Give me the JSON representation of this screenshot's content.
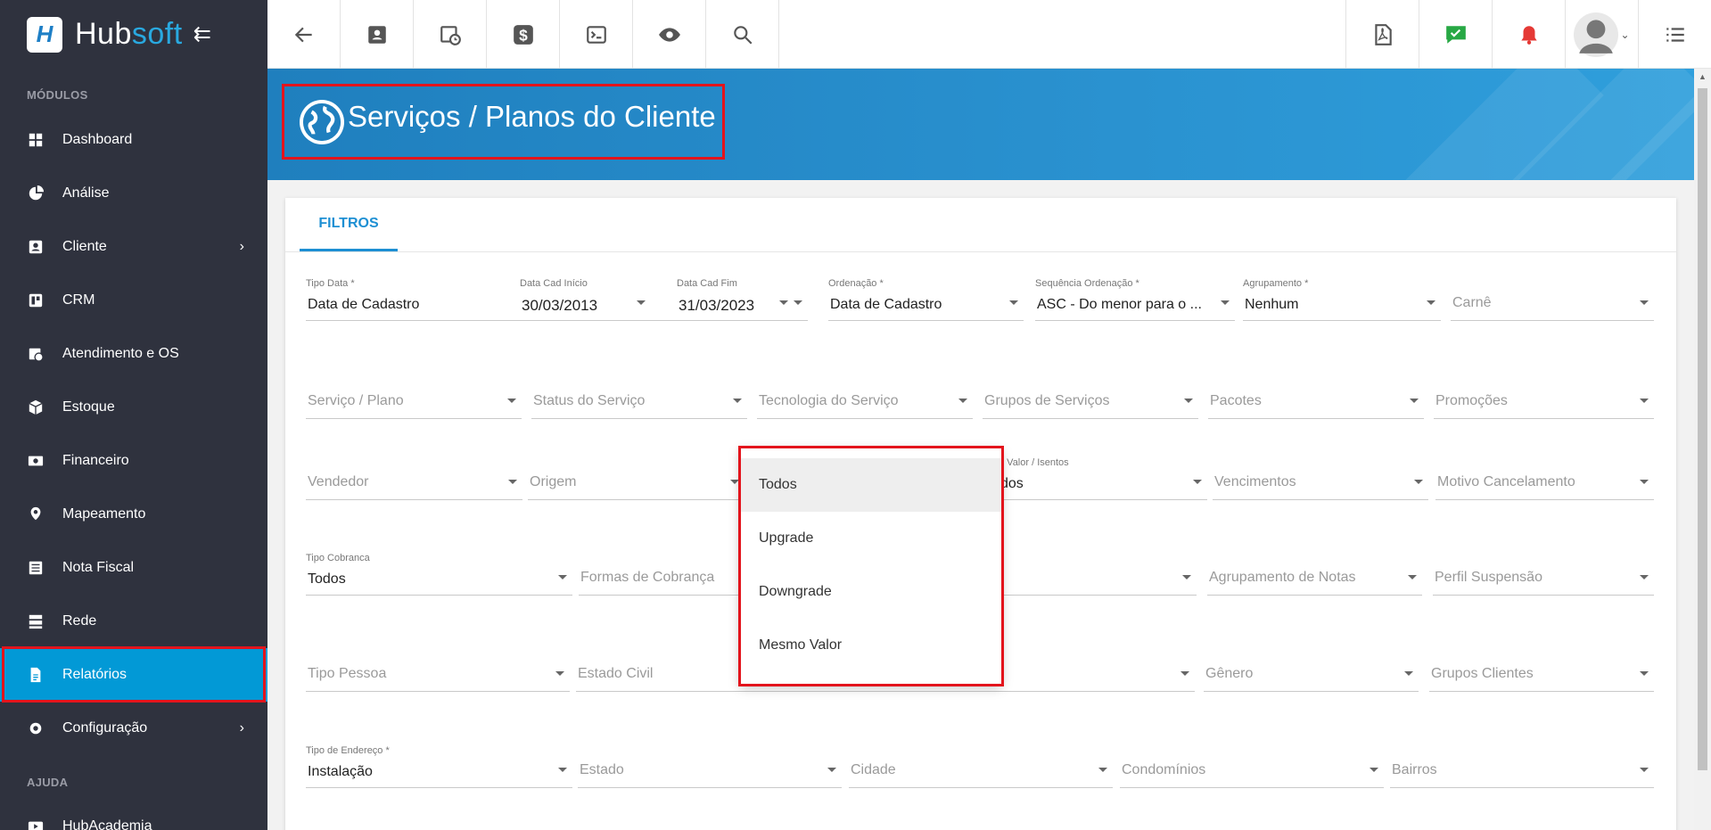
{
  "brand": {
    "hub": "Hub",
    "soft": "soft"
  },
  "sidebar": {
    "modules_label": "MÓDULOS",
    "help_label": "AJUDA",
    "items": [
      {
        "label": "Dashboard",
        "icon": "dashboard-icon"
      },
      {
        "label": "Análise",
        "icon": "pie-chart-icon"
      },
      {
        "label": "Cliente",
        "icon": "contact-card-icon"
      },
      {
        "label": "CRM",
        "icon": "crm-board-icon"
      },
      {
        "label": "Atendimento e OS",
        "icon": "calendar-clock-icon"
      },
      {
        "label": "Estoque",
        "icon": "box-icon"
      },
      {
        "label": "Financeiro",
        "icon": "money-icon"
      },
      {
        "label": "Mapeamento",
        "icon": "map-pin-icon"
      },
      {
        "label": "Nota Fiscal",
        "icon": "document-list-icon"
      },
      {
        "label": "Rede",
        "icon": "server-icon"
      },
      {
        "label": "Relatórios",
        "icon": "report-icon"
      },
      {
        "label": "Configuração",
        "icon": "gear-icon"
      }
    ],
    "help_items": [
      {
        "label": "HubAcademia",
        "icon": "video-icon"
      }
    ]
  },
  "page": {
    "title": "Serviços / Planos do Cliente"
  },
  "tabs": {
    "filters": "FILTROS"
  },
  "filters": {
    "tipo_data": {
      "label": "Tipo Data *",
      "value": "Data de Cadastro"
    },
    "data_inicio": {
      "label": "Data Cad Início",
      "value": "30/03/2013"
    },
    "data_fim": {
      "label": "Data Cad Fim",
      "value": "31/03/2023"
    },
    "ordenacao": {
      "label": "Ordenação *",
      "value": "Data de Cadastro"
    },
    "sequencia": {
      "label": "Sequência Ordenação *",
      "value": "ASC - Do menor para o ..."
    },
    "agrupamento": {
      "label": "Agrupamento *",
      "value": "Nenhum"
    },
    "carne": {
      "placeholder": "Carnê"
    },
    "servico_plano": {
      "placeholder": "Serviço / Plano"
    },
    "status_servico": {
      "placeholder": "Status do Serviço"
    },
    "tecnologia": {
      "placeholder": "Tecnologia do Serviço"
    },
    "grupos_servicos": {
      "placeholder": "Grupos de Serviços"
    },
    "pacotes": {
      "placeholder": "Pacotes"
    },
    "promocoes": {
      "placeholder": "Promoções"
    },
    "vendedor": {
      "placeholder": "Vendedor"
    },
    "origem": {
      "placeholder": "Origem"
    },
    "valor_isentos": {
      "label": "n Valor / Isentos",
      "value": "dos"
    },
    "vencimentos": {
      "placeholder": "Vencimentos"
    },
    "motivo_cancelamento": {
      "placeholder": "Motivo Cancelamento"
    },
    "tipo_cobranca": {
      "label": "Tipo Cobranca",
      "value": "Todos"
    },
    "formas_cobranca": {
      "placeholder": "Formas de Cobrança"
    },
    "agrupamento_notas": {
      "placeholder": "Agrupamento de Notas"
    },
    "perfil_suspensao": {
      "placeholder": "Perfil Suspensão"
    },
    "tipo_pessoa": {
      "placeholder": "Tipo Pessoa"
    },
    "estado_civil": {
      "placeholder": "Estado Civil"
    },
    "genero": {
      "placeholder": "Gênero"
    },
    "grupos_clientes": {
      "placeholder": "Grupos Clientes"
    },
    "tipo_endereco": {
      "label": "Tipo de Endereço *",
      "value": "Instalação"
    },
    "estado": {
      "placeholder": "Estado"
    },
    "cidade": {
      "placeholder": "Cidade"
    },
    "condominios": {
      "placeholder": "Condomínios"
    },
    "bairros": {
      "placeholder": "Bairros"
    }
  },
  "dropdown": {
    "options": [
      "Todos",
      "Upgrade",
      "Downgrade",
      "Mesmo Valor"
    ],
    "highlighted": "Todos"
  },
  "colors": {
    "accent": "#0299d6",
    "sidebar": "#2f323e",
    "highlight_box": "#e3141c",
    "notify_green": "#27a844",
    "alert_red": "#e53935"
  }
}
